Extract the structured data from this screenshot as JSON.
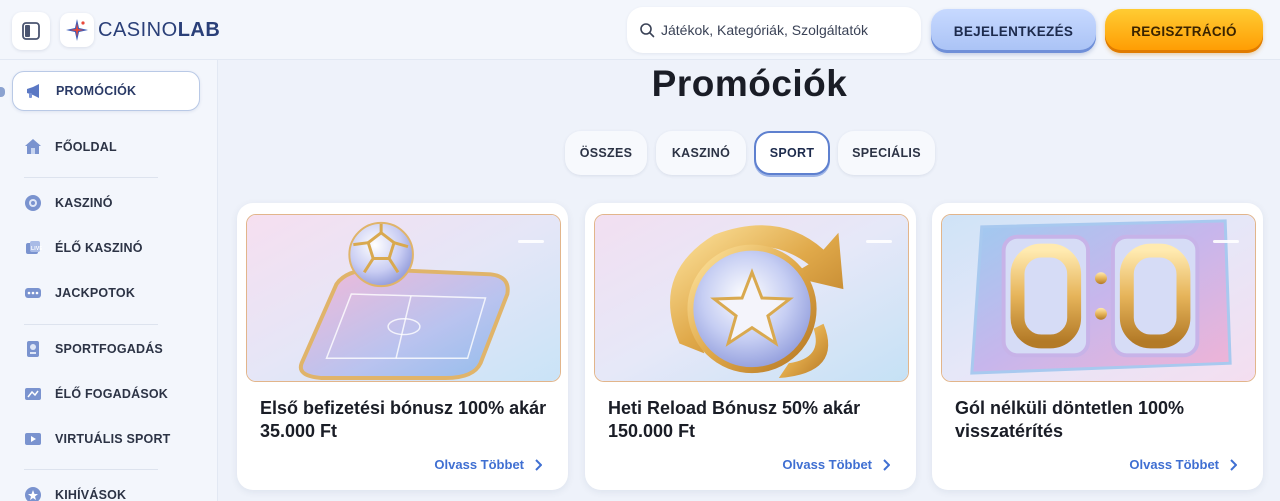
{
  "header": {
    "logo_text_a": "CASINO",
    "logo_text_b": "LAB",
    "search_placeholder": "Játékok, Kategóriák, Szolgáltatók",
    "login_label": "BEJELENTKEZÉS",
    "register_label": "REGISZTRÁCIÓ"
  },
  "sidebar": {
    "items": [
      {
        "label": "PROMÓCIÓK",
        "icon": "megaphone-icon",
        "active": true
      },
      {
        "label": "FŐOLDAL",
        "icon": "home-icon"
      },
      {
        "label": "KASZINÓ",
        "icon": "casino-chip-icon"
      },
      {
        "label": "ÉLŐ KASZINÓ",
        "icon": "live-casino-icon"
      },
      {
        "label": "JACKPOTOK",
        "icon": "jackpot-icon"
      },
      {
        "label": "SPORTFOGADÁS",
        "icon": "sportsbook-icon"
      },
      {
        "label": "ÉLŐ FOGADÁSOK",
        "icon": "live-betting-icon"
      },
      {
        "label": "VIRTUÁLIS SPORT",
        "icon": "virtual-sport-icon"
      },
      {
        "label": "KIHÍVÁSOK",
        "icon": "challenges-icon"
      }
    ]
  },
  "main": {
    "title": "Promóciók",
    "tabs": [
      {
        "label": "ÖSSZES"
      },
      {
        "label": "KASZINÓ"
      },
      {
        "label": "SPORT",
        "active": true
      },
      {
        "label": "SPECIÁLIS"
      }
    ],
    "cards": [
      {
        "title": "Első befizetési bónusz 100% akár 35.000 Ft",
        "link": "Olvass Többet"
      },
      {
        "title": "Heti Reload Bónusz 50% akár 150.000 Ft",
        "link": "Olvass Többet"
      },
      {
        "title": "Gól nélküli döntetlen 100% visszatérítés",
        "link": "Olvass Többet"
      }
    ]
  },
  "colors": {
    "accent_blue": "#3f6fd2",
    "register_orange": "#ff9a00",
    "login_blue": "#a9c2f5"
  }
}
